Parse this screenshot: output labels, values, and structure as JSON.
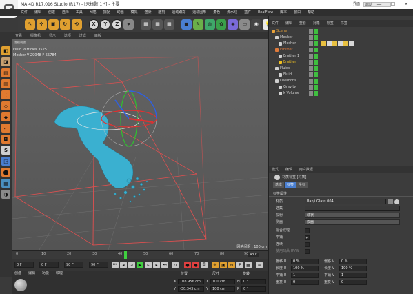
{
  "titlebar": {
    "title": "MA 4D R17.016 Studio (R17) - [未标题 1 *] - 主要",
    "layout_label": "界面",
    "layout_value": "启动",
    "minimize": "—",
    "maximize": "☐",
    "close": "✕"
  },
  "menubar": {
    "items": [
      "文件",
      "编辑",
      "创建",
      "选择",
      "工具",
      "网格",
      "捕捉",
      "动画",
      "模拟",
      "渲染",
      "雕刻",
      "运动跟踪",
      "运动图形",
      "角色",
      "流水线",
      "插件",
      "RealFlow",
      "脚本",
      "窗口",
      "帮助"
    ]
  },
  "toolbar": {
    "axis_x": "X",
    "axis_y": "Y",
    "axis_z": "Z"
  },
  "viewport": {
    "menu": [
      "查看",
      "摄像机",
      "显示",
      "选项",
      "过滤",
      "面板"
    ],
    "camera_label": "透视视图",
    "info_line1": "Fluid Particles  3525",
    "info_line2": "Mesher V  29048  F  55784",
    "grid_spacing": "网格间距 : 100 cm"
  },
  "timeline": {
    "ticks": [
      "0",
      "10",
      "20",
      "30",
      "40",
      "50",
      "60",
      "70",
      "80",
      "90"
    ],
    "current_frame": "43 F"
  },
  "playback": {
    "start": "0 F",
    "field2": "0 F",
    "end": "90 F",
    "field4": "90 F"
  },
  "material_panel": {
    "menu": [
      "创建",
      "编辑",
      "功能",
      "纹理"
    ]
  },
  "coord_panel": {
    "headers": [
      "位置",
      "尺寸",
      "旋转"
    ],
    "x_label": "X",
    "x_pos": "108.956 cm",
    "x_size_label": "X",
    "x_size": "100 cm",
    "h_label": "H",
    "h_rot": "0 °",
    "y_label": "Y",
    "y_pos": "-30.343 cm",
    "y_size_label": "Y",
    "y_size": "100 cm",
    "p_label": "P",
    "p_rot": "0 °"
  },
  "object_panel": {
    "menu": [
      "文件",
      "编辑",
      "查看",
      "对象",
      "标签",
      "书签"
    ],
    "objects": [
      {
        "name": "Scene",
        "indent": 0,
        "color": "#e8a23a"
      },
      {
        "name": "Mesher",
        "indent": 1,
        "color": "#d0d0d0"
      },
      {
        "name": "Mesher",
        "indent": 2,
        "color": "#d0d0d0"
      },
      {
        "name": "Emitter",
        "indent": 1,
        "color": "#e07a3a"
      },
      {
        "name": "Emitter 1",
        "indent": 2,
        "color": "#d0d0d0"
      },
      {
        "name": "Emitter",
        "indent": 2,
        "color": "#f0c020"
      },
      {
        "name": "Fluids",
        "indent": 1,
        "color": "#d0d0d0"
      },
      {
        "name": "Fluid",
        "indent": 2,
        "color": "#d0d0d0"
      },
      {
        "name": "Daemons",
        "indent": 1,
        "color": "#d0d0d0"
      },
      {
        "name": "Gravity",
        "indent": 2,
        "color": "#d0d0d0"
      },
      {
        "name": "k Volume",
        "indent": 2,
        "color": "#d0d0d0"
      }
    ]
  },
  "attr_panel": {
    "menu": [
      "模式",
      "编辑",
      "用户数据"
    ],
    "tag_title": "材质标签 [材质]",
    "tabs": [
      "基本",
      "标签",
      "坐标"
    ],
    "section": "标签属性",
    "material_label": "材质",
    "material_value": "Banji Glass 004",
    "selection_label": "选集",
    "projection_label": "投射",
    "projection_value": "球状",
    "side_label": "侧面",
    "side_value": "双面",
    "blend_label": "混合纹理",
    "tile_label": "平铺",
    "seamless_label": "连续",
    "uvw_label": "使用凹凸 UVW",
    "offset_u_label": "偏移 U",
    "offset_u": "0 %",
    "offset_v_label": "偏移 V",
    "offset_v": "0 %",
    "length_u_label": "长度 U",
    "length_u": "100 %",
    "length_v_label": "长度 V",
    "length_v": "100 %",
    "tiles_u_label": "平铺 U",
    "tiles_u": "1",
    "tiles_v_label": "平铺 V",
    "tiles_v": "1",
    "repeat_u_label": "重复 U",
    "repeat_u": "0",
    "repeat_v_label": "重复 V",
    "repeat_v": "0"
  }
}
